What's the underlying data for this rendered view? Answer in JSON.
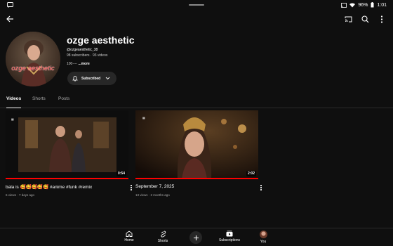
{
  "status_bar": {
    "time": "1:01",
    "battery": "96%",
    "left_icon": "cast-notification-icon"
  },
  "channel": {
    "name": "ozge aesthetic",
    "handle": "@ozgeaesthetic_38",
    "subscribers": "98 subscribers",
    "videos": "93 videos",
    "description": "100---- ",
    "more": "...more",
    "avatar_text": "ozge aesthetic"
  },
  "subscribe": {
    "label": "Subscribed"
  },
  "tabs": [
    {
      "label": "Videos",
      "active": true
    },
    {
      "label": "Shorts",
      "active": false
    },
    {
      "label": "Posts",
      "active": false
    }
  ],
  "videos": [
    {
      "title": "bala is 🥰🥰🥰🥰🥰 #anime #funk #remix",
      "views": "6 views",
      "age": "7 days ago",
      "duration": "0:54",
      "watched_fraction": 1.0
    },
    {
      "title": "September 7, 2025",
      "views": "13 views",
      "age": "2 months ago",
      "duration": "2:02",
      "watched_fraction": 1.0
    }
  ],
  "bottom_nav": [
    {
      "label": "Home",
      "icon": "home-icon"
    },
    {
      "label": "Shorts",
      "icon": "shorts-icon"
    },
    {
      "label": "",
      "icon": "create-icon"
    },
    {
      "label": "Subscriptions",
      "icon": "subscriptions-icon"
    },
    {
      "label": "You",
      "icon": "avatar"
    }
  ],
  "colors": {
    "background": "#0f0f0f",
    "accent": "#ff0000",
    "chip": "#272727"
  }
}
